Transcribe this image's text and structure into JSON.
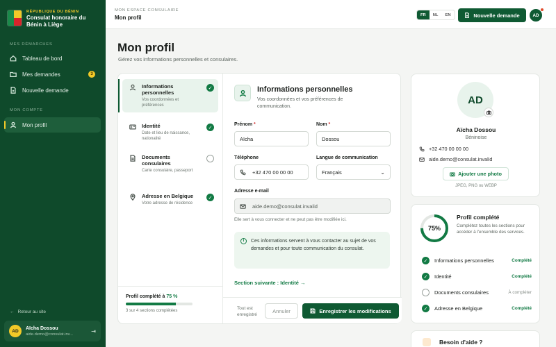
{
  "brand": {
    "country": "RÉPUBLIQUE DU BÉNIN",
    "title": "Consulat honoraire du Bénin à Liège"
  },
  "sidebar": {
    "section1": "MES DÉMARCHES",
    "items": [
      {
        "label": "Tableau de bord",
        "icon": "home-icon"
      },
      {
        "label": "Mes demandes",
        "icon": "folder-icon",
        "badge": "3"
      },
      {
        "label": "Nouvelle demande",
        "icon": "file-plus-icon"
      }
    ],
    "section2": "MON COMPTE",
    "account_items": [
      {
        "label": "Mon profil",
        "icon": "user-icon",
        "active": true
      }
    ],
    "back_label": "Retour au site",
    "user": {
      "initials": "AD",
      "name": "Aïcha Dossou",
      "email": "aide.demo@consulat.inv..."
    }
  },
  "topbar": {
    "section": "MON ESPACE CONSULAIRE",
    "title": "Mon profil",
    "languages": [
      "FR",
      "NL",
      "EN"
    ],
    "active_language": "FR",
    "new_request_label": "Nouvelle demande",
    "avatar_initials": "AD"
  },
  "page": {
    "title": "Mon profil",
    "subtitle": "Gérez vos informations personnelles et consulaires."
  },
  "steps": [
    {
      "title": "Informations personnelles",
      "desc": "Vos coordonnées et préférences",
      "done": true,
      "icon": "user-icon"
    },
    {
      "title": "Identité",
      "desc": "Date et lieu de naissance, nationalité",
      "done": true,
      "icon": "id-card-icon"
    },
    {
      "title": "Documents consulaires",
      "desc": "Carte consulaire, passeport",
      "done": false,
      "icon": "document-icon"
    },
    {
      "title": "Adresse en Belgique",
      "desc": "Votre adresse de résidence",
      "done": true,
      "icon": "map-pin-icon"
    }
  ],
  "progress": {
    "label": "Profil complété à",
    "percent_label": "75 %",
    "value": 0.75,
    "sub": "3 sur 4 sections complétées"
  },
  "form": {
    "title": "Informations personnelles",
    "subtitle": "Vos coordonnées et vos préférences de communication.",
    "first_name_label": "Prénom",
    "first_name": "Aïcha",
    "last_name_label": "Nom",
    "last_name": "Dossou",
    "phone_label": "Téléphone",
    "phone": "+32 470 00 00 00",
    "lang_label": "Langue de communication",
    "lang_value": "Français",
    "email_label": "Adresse e-mail",
    "email": "aide.demo@consulat.invalid",
    "email_hint": "Elle sert à vous connecter et ne peut pas être modifiée ici.",
    "info": "Ces informations servent à vous contacter au sujet de vos demandes et pour toute communication du consulat.",
    "next_link": "Section suivante : Identité",
    "saved_status": "Tout est enregistré",
    "cancel_label": "Annuler",
    "save_label": "Enregistrer les modifications"
  },
  "profile_card": {
    "initials": "AD",
    "name": "Aïcha Dossou",
    "nationality": "Béninoise",
    "phone": "+32 470 00 00 00",
    "email": "aide.demo@consulat.invalid",
    "add_photo_label": "Ajouter une photo",
    "formats": "JPEG, PNG ou WEBP"
  },
  "completion": {
    "percent_label": "75%",
    "value": 0.75,
    "title": "Profil complété",
    "subtitle": "Complétez toutes les sections pour accéder à l'ensemble des services.",
    "rows": [
      {
        "label": "Informations personnelles",
        "status": "Complété",
        "done": true
      },
      {
        "label": "Identité",
        "status": "Complété",
        "done": true
      },
      {
        "label": "Documents consulaires",
        "status": "À compléter",
        "done": false
      },
      {
        "label": "Adresse en Belgique",
        "status": "Complété",
        "done": true
      }
    ]
  },
  "help": {
    "title": "Besoin d'aide ?"
  },
  "colors": {
    "primary": "#0f5a33",
    "sidebar": "#0f4a2b",
    "accent_yellow": "#f2c928",
    "danger": "#d12f2f"
  }
}
